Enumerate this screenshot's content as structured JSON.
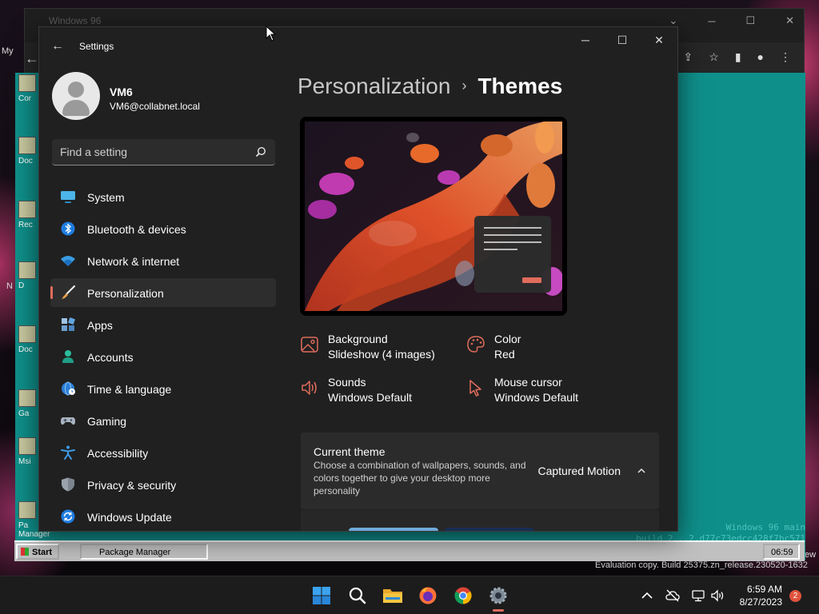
{
  "browser": {
    "tab_title": "Windows 96",
    "menu_label": "My",
    "retro_version_line1": "Windows 96 main",
    "retro_version_line2": "build 2...2.d77c73edcc428f7bc571",
    "retro_taskbar": {
      "start": "Start",
      "app": "Package Manager",
      "clock": "06:59"
    },
    "desktop_icons": [
      "Cor",
      "Doc",
      "Rec",
      "D",
      "Doc",
      "Ga",
      "Msi",
      "Pa Manager"
    ]
  },
  "eval_note": "Evaluation copy. Build 25375.zn_release.230520-1632",
  "settings": {
    "title": "Settings",
    "window_controls": {
      "minimize": "─",
      "maximize": "☐",
      "close": "✕"
    },
    "user": {
      "name": "VM6",
      "email": "VM6@collabnet.local"
    },
    "search_placeholder": "Find a setting",
    "nav": [
      {
        "label": "System",
        "icon": "monitor-icon"
      },
      {
        "label": "Bluetooth & devices",
        "icon": "bluetooth-icon"
      },
      {
        "label": "Network & internet",
        "icon": "wifi-icon"
      },
      {
        "label": "Personalization",
        "icon": "brush-icon",
        "active": true
      },
      {
        "label": "Apps",
        "icon": "apps-icon"
      },
      {
        "label": "Accounts",
        "icon": "person-icon"
      },
      {
        "label": "Time & language",
        "icon": "globe-clock-icon"
      },
      {
        "label": "Gaming",
        "icon": "gamepad-icon"
      },
      {
        "label": "Accessibility",
        "icon": "accessibility-icon"
      },
      {
        "label": "Privacy & security",
        "icon": "shield-icon"
      },
      {
        "label": "Windows Update",
        "icon": "update-icon"
      }
    ],
    "breadcrumb": {
      "parent": "Personalization",
      "separator": "›",
      "current": "Themes"
    },
    "properties": {
      "background": {
        "title": "Background",
        "value": "Slideshow (4 images)"
      },
      "color": {
        "title": "Color",
        "value": "Red"
      },
      "sounds": {
        "title": "Sounds",
        "value": "Windows Default"
      },
      "mouse_cursor": {
        "title": "Mouse cursor",
        "value": "Windows Default"
      }
    },
    "current_theme": {
      "title": "Current theme",
      "description": "Choose a combination of wallpapers, sounds, and colors together to give your desktop more personality",
      "value": "Captured Motion"
    },
    "accent_color": "#e06c5c"
  },
  "taskbar": {
    "apps": [
      "start-icon",
      "search-icon",
      "file-explorer-icon",
      "firefox-icon",
      "chrome-icon",
      "settings-icon"
    ],
    "time": "6:59 AM",
    "date": "8/27/2023",
    "notification_count": "2"
  }
}
